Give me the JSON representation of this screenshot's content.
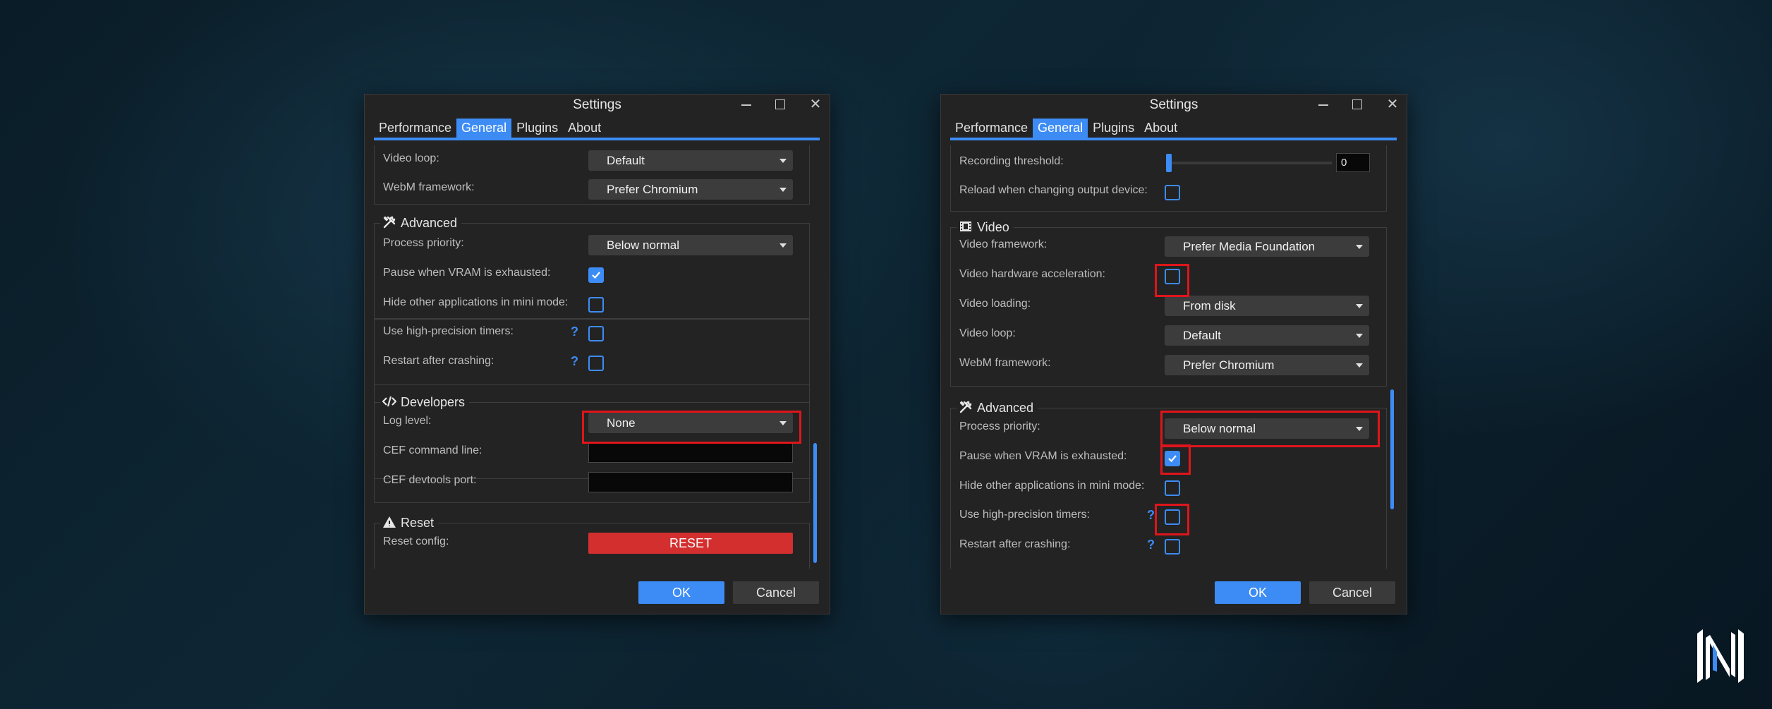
{
  "left_window": {
    "title": "Settings",
    "tabs": [
      "Performance",
      "General",
      "Plugins",
      "About"
    ],
    "active_tab": "General",
    "rows_top": [
      {
        "label": "Video loop:",
        "value": "Default"
      },
      {
        "label": "WebM framework:",
        "value": "Prefer Chromium"
      }
    ],
    "advanced": {
      "title": "Advanced",
      "process_priority_label": "Process priority:",
      "process_priority_value": "Below normal",
      "pause_vram_label": "Pause when VRAM is exhausted:",
      "pause_vram_checked": true,
      "hide_apps_label": "Hide other applications in mini mode:",
      "hide_apps_checked": false,
      "high_precision_label": "Use high-precision timers:",
      "high_precision_checked": false,
      "restart_label": "Restart after crashing:",
      "restart_checked": false,
      "help": "?"
    },
    "developers": {
      "title": "Developers",
      "log_level_label": "Log level:",
      "log_level_value": "None",
      "cef_cmd_label": "CEF command line:",
      "cef_cmd_value": "",
      "cef_devtools_label": "CEF devtools port:",
      "cef_devtools_value": ""
    },
    "reset": {
      "title": "Reset",
      "reset_config_label": "Reset config:",
      "reset_button": "RESET"
    },
    "ok": "OK",
    "cancel": "Cancel"
  },
  "right_window": {
    "title": "Settings",
    "tabs": [
      "Performance",
      "General",
      "Plugins",
      "About"
    ],
    "active_tab": "General",
    "audio_rows": {
      "recording_threshold_label": "Recording threshold:",
      "recording_threshold_value": "0",
      "recording_threshold_level": 0,
      "reload_label": "Reload when changing output device:",
      "reload_checked": false
    },
    "video": {
      "title": "Video",
      "framework_label": "Video framework:",
      "framework_value": "Prefer Media Foundation",
      "hw_accel_label": "Video hardware acceleration:",
      "hw_accel_checked": false,
      "loading_label": "Video loading:",
      "loading_value": "From disk",
      "loop_label": "Video loop:",
      "loop_value": "Default",
      "webm_label": "WebM framework:",
      "webm_value": "Prefer Chromium"
    },
    "advanced": {
      "title": "Advanced",
      "process_priority_label": "Process priority:",
      "process_priority_value": "Below normal",
      "pause_vram_label": "Pause when VRAM is exhausted:",
      "pause_vram_checked": true,
      "hide_apps_label": "Hide other applications in mini mode:",
      "hide_apps_checked": false,
      "high_precision_label": "Use high-precision timers:",
      "high_precision_checked": false,
      "restart_label": "Restart after crashing:",
      "restart_checked": false,
      "help": "?"
    },
    "ok": "OK",
    "cancel": "Cancel"
  },
  "colors": {
    "accent": "#3d8cf5",
    "highlight": "#e0151b",
    "reset": "#d32f2f",
    "window_bg": "#232323"
  }
}
